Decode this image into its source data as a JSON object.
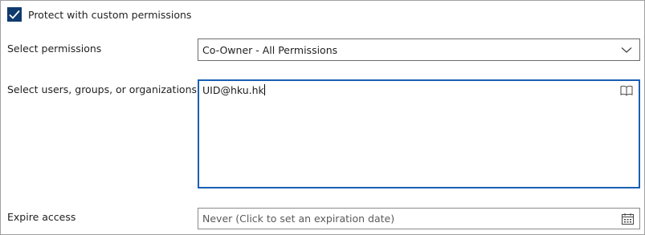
{
  "protect": {
    "checked": true,
    "label": "Protect with custom permissions"
  },
  "permissions": {
    "label": "Select permissions",
    "value": "Co-Owner - All Permissions"
  },
  "users": {
    "label": "Select users, groups, or organizations",
    "value": "UID@hku.hk"
  },
  "expire": {
    "label": "Expire access",
    "placeholder": "Never (Click to set an expiration date)"
  },
  "icons": {
    "checkbox": "checkmark-icon",
    "select": "chevron-down-icon",
    "users": "address-book-icon",
    "expire": "calendar-icon"
  },
  "colors": {
    "checkbox_fill": "#0f3b6f",
    "focus_border": "#1a5fb4"
  }
}
